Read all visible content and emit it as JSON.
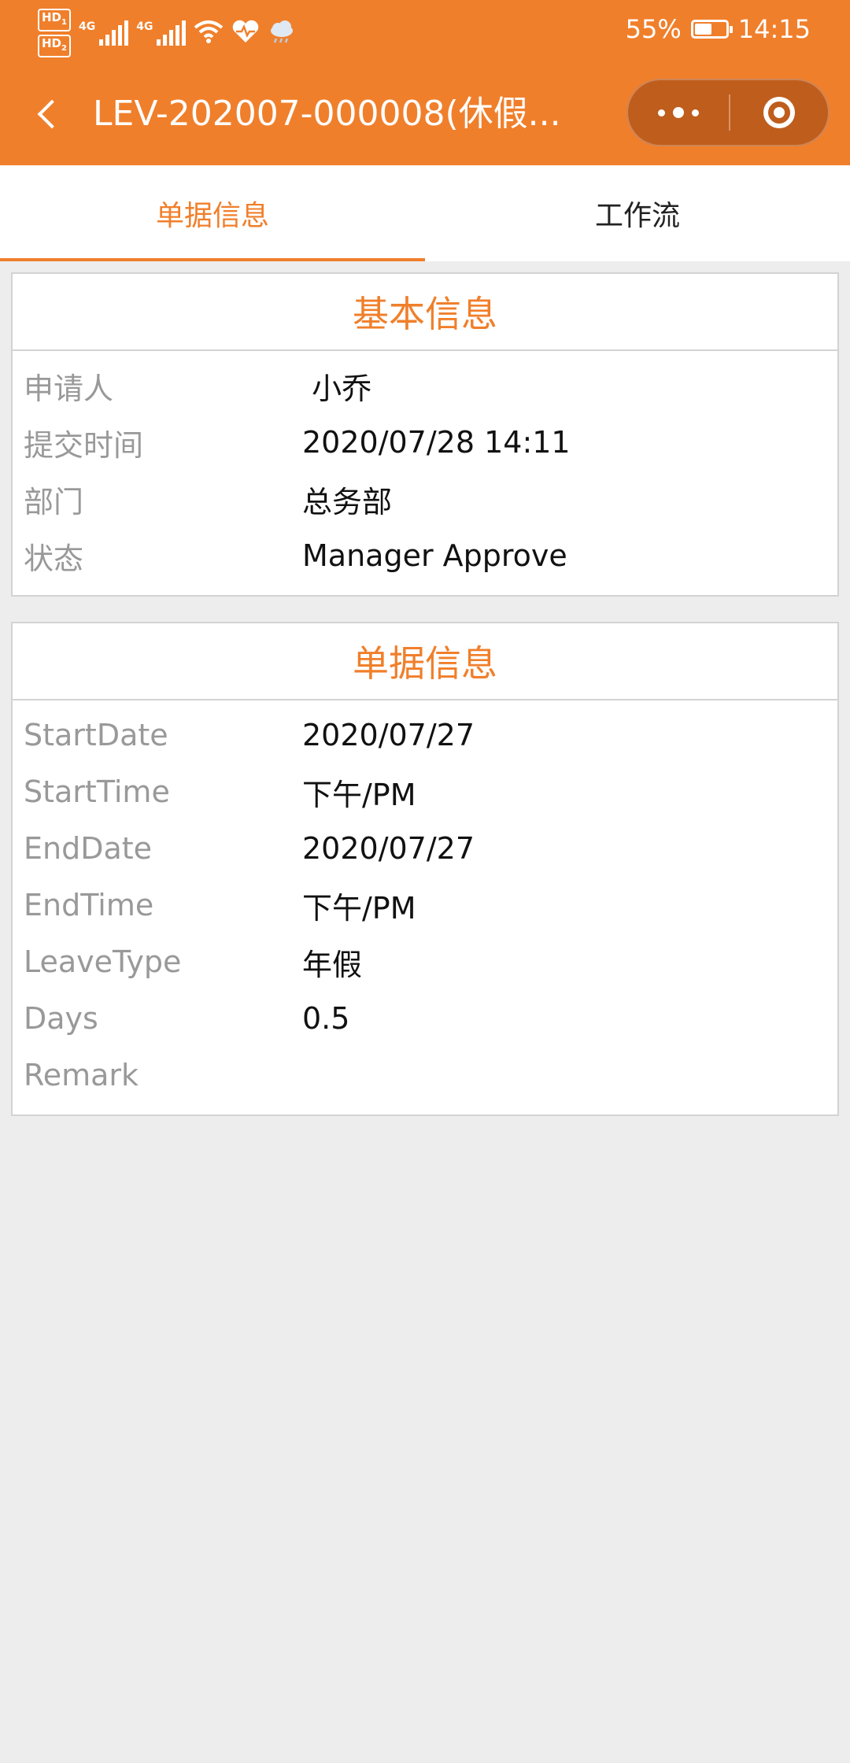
{
  "statusbar": {
    "hd1": "HD",
    "hd1_sub": "1",
    "hd2": "HD",
    "hd2_sub": "2",
    "net1": "4G",
    "net2": "4G",
    "battery_percent": "55%",
    "battery_level": 0.55,
    "time": "14:15",
    "icons": [
      "wifi-icon",
      "heart-icon",
      "cloud-icon"
    ]
  },
  "header": {
    "title": "LEV-202007-000008(休假...",
    "accent_color": "#f07f2b"
  },
  "tabs": [
    {
      "label": "单据信息",
      "active": true
    },
    {
      "label": "工作流",
      "active": false
    }
  ],
  "basic_info": {
    "heading": "基本信息",
    "rows": [
      {
        "label": "申请人",
        "value": " 小乔"
      },
      {
        "label": "提交时间",
        "value": "2020/07/28 14:11"
      },
      {
        "label": "部门",
        "value": "总务部"
      },
      {
        "label": "状态",
        "value": "Manager Approve"
      }
    ]
  },
  "document_info": {
    "heading": "单据信息",
    "rows": [
      {
        "label": "StartDate",
        "value": "2020/07/27"
      },
      {
        "label": "StartTime",
        "value": "下午/PM"
      },
      {
        "label": "EndDate",
        "value": "2020/07/27"
      },
      {
        "label": "EndTime",
        "value": "下午/PM"
      },
      {
        "label": "LeaveType",
        "value": "年假"
      },
      {
        "label": "Days",
        "value": "0.5"
      },
      {
        "label": "Remark",
        "value": ""
      }
    ]
  }
}
